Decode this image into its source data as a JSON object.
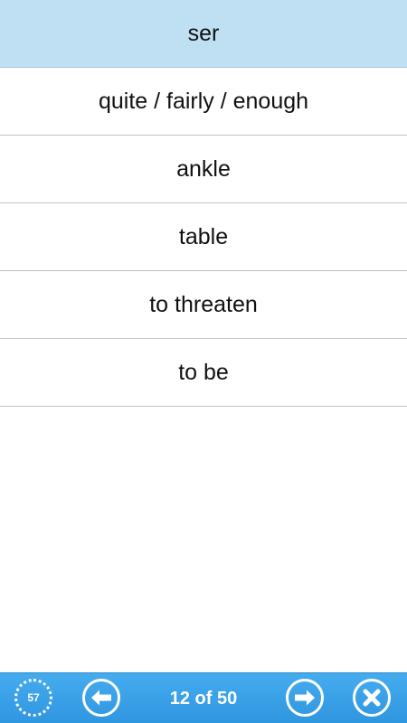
{
  "question": {
    "word": "ser"
  },
  "options": [
    {
      "label": "quite / fairly / enough"
    },
    {
      "label": "ankle"
    },
    {
      "label": "table"
    },
    {
      "label": "to threaten"
    },
    {
      "label": "to be"
    }
  ],
  "bottom_bar": {
    "timer_value": "57",
    "progress_text": "12 of 50",
    "prev_icon": "arrow-left-icon",
    "next_icon": "arrow-right-icon",
    "close_icon": "close-icon"
  },
  "colors": {
    "question_bg": "#bfe0f3",
    "bar_bg": "#3a9fe6"
  }
}
